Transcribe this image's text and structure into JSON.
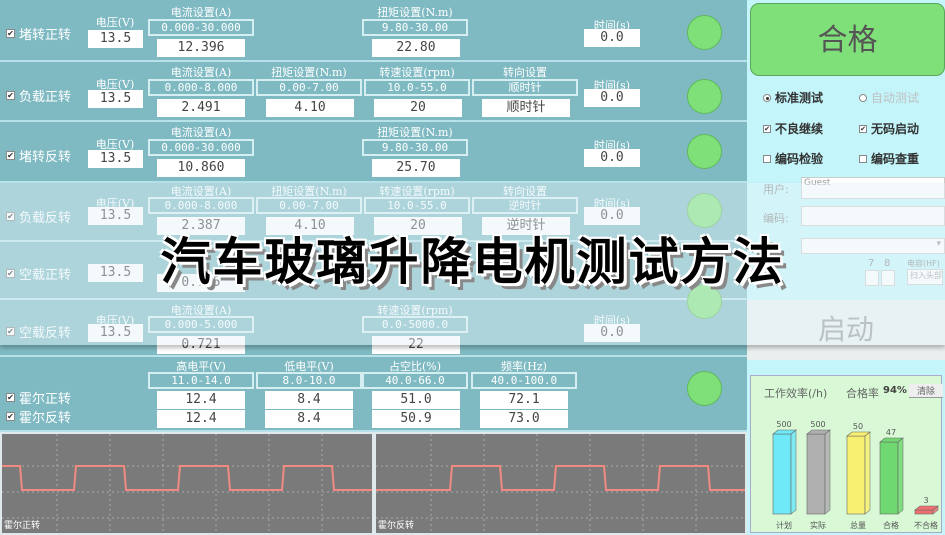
{
  "rows": [
    {
      "name": "堵转正转",
      "checked": true,
      "voltage_label": "电压(V)",
      "voltage": "13.5",
      "current_label": "电流设置(A)",
      "current_range": "0.000-30.000",
      "current": "12.396",
      "torque_label": "扭矩设置(N.m)",
      "torque_range": "9.80-30.00",
      "torque": "22.80",
      "time_label": "时间(s)",
      "time": "0.0"
    },
    {
      "name": "负载正转",
      "checked": true,
      "voltage_label": "电压(V)",
      "voltage": "13.5",
      "current_label": "电流设置(A)",
      "current_range": "0.000-8.000",
      "current": "2.491",
      "torque_label": "扭矩设置(N.m)",
      "torque_range": "0.00-7.00",
      "torque": "4.10",
      "speed_label": "转速设置(rpm)",
      "speed_range": "10.0-55.0",
      "speed": "20",
      "dir_label": "转向设置",
      "dir_range": "顺时针",
      "dir": "顺时针",
      "time_label": "时间(s)",
      "time": "0.0"
    },
    {
      "name": "堵转反转",
      "checked": true,
      "voltage_label": "电压(V)",
      "voltage": "13.5",
      "current_label": "电流设置(A)",
      "current_range": "0.000-30.000",
      "current": "10.860",
      "torque_label": "扭矩设置(N.m)",
      "torque_range": "9.80-30.00",
      "torque": "25.70",
      "time_label": "时间(s)",
      "time": "0.0"
    },
    {
      "name": "负载反转",
      "checked": true,
      "voltage_label": "电压(V)",
      "voltage": "13.5",
      "current_label": "电流设置(A)",
      "current_range": "0.000-8.000",
      "current": "2.387",
      "torque_label": "扭矩设置(N.m)",
      "torque_range": "0.00-7.00",
      "torque": "4.10",
      "speed_label": "转速设置(rpm)",
      "speed_range": "10.0-55.0",
      "speed": "20",
      "dir_label": "转向设置",
      "dir_range": "逆时针",
      "dir": "逆时针",
      "time_label": "时间(s)",
      "time": "0.0"
    },
    {
      "name": "空载正转",
      "checked": true,
      "voltage": "13.5",
      "current": "0.795"
    },
    {
      "name": "空载反转",
      "checked": true,
      "voltage_label": "电压(V)",
      "voltage": "13.5",
      "current_label": "电流设置(A)",
      "current_range": "0.000-5.000",
      "current": "0.721",
      "speed_label": "转速设置(rpm)",
      "speed_range": "0.0-5000.0",
      "speed": "22",
      "time_label": "时间(s)",
      "time": "0.0"
    }
  ],
  "hall": {
    "rows": [
      {
        "name": "霍尔正转",
        "checked": true,
        "high": "12.4",
        "low": "8.4",
        "duty": "51.0",
        "freq": "72.1"
      },
      {
        "name": "霍尔反转",
        "checked": true,
        "high": "12.4",
        "low": "8.4",
        "duty": "50.9",
        "freq": "73.0"
      }
    ],
    "high_label": "高电平(V)",
    "high_range": "11.0-14.0",
    "low_label": "低电平(V)",
    "low_range": "8.0-10.0",
    "duty_label": "占空比(%)",
    "duty_range": "40.0-66.0",
    "freq_label": "频率(Hz)",
    "freq_range": "40.0-100.0"
  },
  "scopes": [
    {
      "caption": "霍尔正转"
    },
    {
      "caption": "霍尔反转"
    }
  ],
  "right": {
    "result": "合格",
    "options": [
      {
        "label": "标准测试",
        "type": "radio",
        "checked": true,
        "enabled": true
      },
      {
        "label": "自动测试",
        "type": "radio",
        "checked": false,
        "enabled": false
      },
      {
        "label": "不良继续",
        "type": "checkbox",
        "checked": true,
        "enabled": true
      },
      {
        "label": "无码启动",
        "type": "checkbox",
        "checked": true,
        "enabled": true
      },
      {
        "label": "编码检验",
        "type": "checkbox",
        "checked": false,
        "enabled": true
      },
      {
        "label": "编码查重",
        "type": "checkbox",
        "checked": false,
        "enabled": true
      }
    ],
    "user_label": "用户:",
    "user_value": "Guest",
    "code_label": "编码:",
    "code_value": "",
    "slots": [
      "7",
      "8"
    ],
    "cap_label": "电容(HF)",
    "cap_placeholder": "扫入头部",
    "start_label": "启动"
  },
  "stats": {
    "efficiency_label": "工作效率(/h)",
    "pass_rate_label": "合格率",
    "pass_rate": "94%",
    "clear_label": "清除"
  },
  "chart_data": {
    "type": "bar",
    "categories": [
      "计划",
      "实际",
      "总量",
      "合格",
      "不合格"
    ],
    "values": [
      500,
      500,
      50,
      47,
      3
    ],
    "colors": [
      "#6fe8f8",
      "#b0b0b0",
      "#f8f070",
      "#70d870",
      "#f07070"
    ]
  },
  "overlay_title": "汽车玻璃升降电机测试方法"
}
